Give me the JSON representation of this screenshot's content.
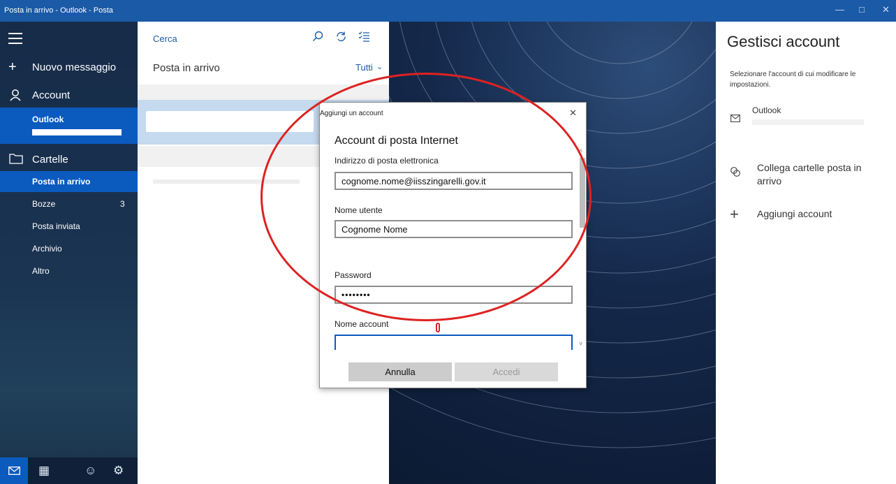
{
  "window": {
    "title": "Posta in arrivo - Outlook - Posta",
    "minimize_icon": "—",
    "maximize_icon": "□",
    "close_icon": "✕"
  },
  "nav": {
    "new_message": "Nuovo messaggio",
    "accounts_label": "Account",
    "account_name": "Outlook",
    "folders_label": "Cartelle",
    "folders": [
      {
        "label": "Posta in arrivo",
        "count": ""
      },
      {
        "label": "Bozze",
        "count": "3"
      },
      {
        "label": "Posta inviata",
        "count": ""
      },
      {
        "label": "Archivio",
        "count": ""
      },
      {
        "label": "Altro",
        "count": ""
      }
    ]
  },
  "list": {
    "search_placeholder": "Cerca",
    "folder_title": "Posta in arrivo",
    "filter_label": "Tutti"
  },
  "dialog": {
    "title": "Aggiungi un account",
    "heading": "Account di posta Internet",
    "email_label": "Indirizzo di posta elettronica",
    "email_value": "cognome.nome@iisszingarelli.gov.it",
    "username_label": "Nome utente",
    "username_value": "Cognome Nome",
    "password_label": "Password",
    "password_value": "••••••••",
    "account_name_label": "Nome account",
    "account_name_value": "",
    "cancel_label": "Annulla",
    "signin_label": "Accedi"
  },
  "right": {
    "title": "Gestisci account",
    "description": "Selezionare l'account di cui modificare le impostazioni.",
    "account_name": "Outlook",
    "link_inboxes": "Collega cartelle posta in arrivo",
    "add_account": "Aggiungi account"
  },
  "colors": {
    "accent": "#0b5bbf",
    "titlebar": "#1b5aa6",
    "annotation": "#d22222"
  }
}
